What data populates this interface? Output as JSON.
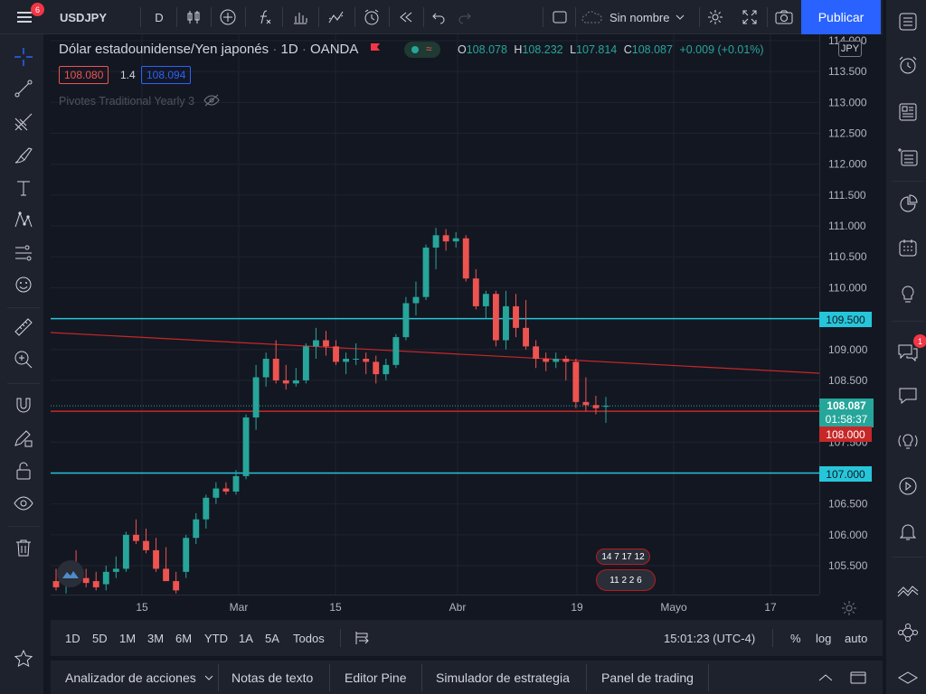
{
  "toolbar": {
    "symbol": "USDJPY",
    "interval": "D",
    "layout_name": "Sin nombre",
    "publish_label": "Publicar",
    "menu_badge": "6"
  },
  "legend": {
    "title": "Dólar estadounidense/Yen japonés",
    "interval": "1D",
    "exchange": "OANDA",
    "open_label": "O",
    "open": "108.078",
    "high_label": "H",
    "high": "108.232",
    "low_label": "L",
    "low": "107.814",
    "close_label": "C",
    "close": "108.087",
    "change": "+0.009 (+0.01%)",
    "bid": "108.080",
    "spread": "1.4",
    "ask": "108.094",
    "indicator": "Pivotes Traditional Yearly 3"
  },
  "price_axis": {
    "currency": "JPY",
    "current_price": "108.087",
    "countdown": "01:58:37",
    "levels": [
      {
        "label": "109.500",
        "value": 109.5,
        "color": "#26c6da"
      },
      {
        "label": "108.000",
        "value": 108.0,
        "color": "#c62828"
      },
      {
        "label": "107.000",
        "value": 107.0,
        "color": "#26c6da"
      }
    ]
  },
  "period_bar": {
    "periods": [
      "1D",
      "5D",
      "1M",
      "3M",
      "6M",
      "YTD",
      "1A",
      "5A",
      "Todos"
    ],
    "clock": "15:01:23 (UTC-4)",
    "percent": "%",
    "log": "log",
    "auto": "auto"
  },
  "tabs": [
    "Analizador de acciones",
    "Notas de texto",
    "Editor Pine",
    "Simulador de estrategia",
    "Panel de trading"
  ],
  "right_badge": "1",
  "events": {
    "row1": "14 7 17 12",
    "row2": "11 2 2 6"
  },
  "colors": {
    "up": "#26a69a",
    "down": "#ef5350",
    "accent": "#2962ff",
    "level_cyan": "#26c6da",
    "level_red": "#c62828",
    "trend": "#c62828"
  },
  "chart_data": {
    "type": "candlestick",
    "symbol": "USDJPY",
    "ylim": [
      105.0,
      114.0
    ],
    "y_ticks": [
      "105.500",
      "106.000",
      "106.500",
      "107.000",
      "107.500",
      "108.000",
      "108.500",
      "109.000",
      "109.500",
      "110.000",
      "110.500",
      "111.000",
      "111.500",
      "112.000",
      "112.500",
      "113.000",
      "113.500",
      "114.000"
    ],
    "x_ticks": [
      "15",
      "Mar",
      "15",
      "Abr",
      "19",
      "Mayo",
      "17"
    ],
    "candles": [
      {
        "o": 105.25,
        "h": 105.45,
        "l": 105.1,
        "c": 105.15
      },
      {
        "o": 105.2,
        "h": 105.4,
        "l": 105.05,
        "c": 105.3
      },
      {
        "o": 105.35,
        "h": 105.75,
        "l": 105.2,
        "c": 105.3
      },
      {
        "o": 105.3,
        "h": 105.45,
        "l": 105.15,
        "c": 105.22
      },
      {
        "o": 105.25,
        "h": 105.4,
        "l": 105.1,
        "c": 105.15
      },
      {
        "o": 105.2,
        "h": 105.5,
        "l": 105.1,
        "c": 105.4
      },
      {
        "o": 105.4,
        "h": 105.65,
        "l": 105.3,
        "c": 105.45
      },
      {
        "o": 105.45,
        "h": 106.05,
        "l": 105.4,
        "c": 106.0
      },
      {
        "o": 106.0,
        "h": 106.25,
        "l": 105.85,
        "c": 105.9
      },
      {
        "o": 105.9,
        "h": 106.1,
        "l": 105.7,
        "c": 105.75
      },
      {
        "o": 105.75,
        "h": 105.95,
        "l": 105.4,
        "c": 105.45
      },
      {
        "o": 105.45,
        "h": 105.8,
        "l": 105.25,
        "c": 105.25
      },
      {
        "o": 105.25,
        "h": 105.4,
        "l": 105.05,
        "c": 105.1
      },
      {
        "o": 105.4,
        "h": 106.0,
        "l": 105.3,
        "c": 105.95
      },
      {
        "o": 105.95,
        "h": 106.35,
        "l": 105.85,
        "c": 106.25
      },
      {
        "o": 106.25,
        "h": 106.65,
        "l": 106.1,
        "c": 106.6
      },
      {
        "o": 106.6,
        "h": 106.85,
        "l": 106.5,
        "c": 106.75
      },
      {
        "o": 106.75,
        "h": 106.85,
        "l": 106.65,
        "c": 106.7
      },
      {
        "o": 106.7,
        "h": 107.05,
        "l": 106.65,
        "c": 106.95
      },
      {
        "o": 106.95,
        "h": 107.95,
        "l": 106.9,
        "c": 107.9
      },
      {
        "o": 107.9,
        "h": 108.75,
        "l": 107.7,
        "c": 108.55
      },
      {
        "o": 108.55,
        "h": 108.95,
        "l": 108.4,
        "c": 108.85
      },
      {
        "o": 108.85,
        "h": 109.15,
        "l": 108.45,
        "c": 108.5
      },
      {
        "o": 108.5,
        "h": 108.75,
        "l": 108.35,
        "c": 108.45
      },
      {
        "o": 108.45,
        "h": 108.7,
        "l": 108.4,
        "c": 108.5
      },
      {
        "o": 108.5,
        "h": 109.1,
        "l": 108.45,
        "c": 109.05
      },
      {
        "o": 109.05,
        "h": 109.35,
        "l": 108.85,
        "c": 109.15
      },
      {
        "o": 109.15,
        "h": 109.3,
        "l": 108.9,
        "c": 109.05
      },
      {
        "o": 109.05,
        "h": 109.15,
        "l": 108.75,
        "c": 108.8
      },
      {
        "o": 108.8,
        "h": 108.95,
        "l": 108.6,
        "c": 108.85
      },
      {
        "o": 108.85,
        "h": 109.1,
        "l": 108.75,
        "c": 108.85
      },
      {
        "o": 108.85,
        "h": 108.95,
        "l": 108.6,
        "c": 108.8
      },
      {
        "o": 108.8,
        "h": 108.9,
        "l": 108.45,
        "c": 108.6
      },
      {
        "o": 108.6,
        "h": 108.85,
        "l": 108.5,
        "c": 108.75
      },
      {
        "o": 108.75,
        "h": 109.25,
        "l": 108.7,
        "c": 109.2
      },
      {
        "o": 109.2,
        "h": 109.85,
        "l": 109.15,
        "c": 109.75
      },
      {
        "o": 109.75,
        "h": 110.1,
        "l": 109.55,
        "c": 109.85
      },
      {
        "o": 109.85,
        "h": 110.7,
        "l": 109.8,
        "c": 110.65
      },
      {
        "o": 110.65,
        "h": 110.97,
        "l": 110.3,
        "c": 110.85
      },
      {
        "o": 110.85,
        "h": 110.95,
        "l": 110.6,
        "c": 110.75
      },
      {
        "o": 110.75,
        "h": 110.9,
        "l": 110.65,
        "c": 110.8
      },
      {
        "o": 110.8,
        "h": 110.85,
        "l": 110.1,
        "c": 110.15
      },
      {
        "o": 110.15,
        "h": 110.3,
        "l": 109.65,
        "c": 109.7
      },
      {
        "o": 109.7,
        "h": 109.95,
        "l": 109.5,
        "c": 109.9
      },
      {
        "o": 109.9,
        "h": 109.95,
        "l": 109.05,
        "c": 109.15
      },
      {
        "o": 109.15,
        "h": 109.95,
        "l": 109.0,
        "c": 109.7
      },
      {
        "o": 109.7,
        "h": 109.9,
        "l": 109.2,
        "c": 109.35
      },
      {
        "o": 109.35,
        "h": 109.8,
        "l": 109.0,
        "c": 109.05
      },
      {
        "o": 109.05,
        "h": 109.15,
        "l": 108.7,
        "c": 108.85
      },
      {
        "o": 108.85,
        "h": 108.95,
        "l": 108.65,
        "c": 108.8
      },
      {
        "o": 108.8,
        "h": 108.95,
        "l": 108.7,
        "c": 108.85
      },
      {
        "o": 108.85,
        "h": 108.9,
        "l": 108.5,
        "c": 108.8
      },
      {
        "o": 108.8,
        "h": 108.85,
        "l": 108.05,
        "c": 108.15
      },
      {
        "o": 108.15,
        "h": 108.55,
        "l": 108.0,
        "c": 108.1
      },
      {
        "o": 108.1,
        "h": 108.25,
        "l": 107.95,
        "c": 108.05
      },
      {
        "o": 108.078,
        "h": 108.232,
        "l": 107.814,
        "c": 108.087
      }
    ]
  }
}
